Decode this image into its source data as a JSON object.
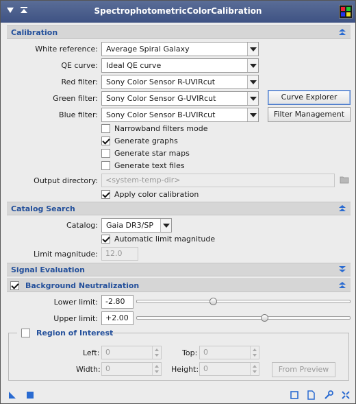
{
  "window": {
    "title": "SpectrophotometricColorCalibration"
  },
  "sections": {
    "calibration": "Calibration",
    "catalog_search": "Catalog Search",
    "signal_evaluation": "Signal Evaluation",
    "background_neutralization": "Background Neutralization"
  },
  "calibration": {
    "white_reference": {
      "label": "White reference:",
      "value": "Average Spiral Galaxy"
    },
    "qe_curve": {
      "label": "QE curve:",
      "value": "Ideal QE curve"
    },
    "red_filter": {
      "label": "Red filter:",
      "value": "Sony Color Sensor R-UVIRcut"
    },
    "green_filter": {
      "label": "Green filter:",
      "value": "Sony Color Sensor G-UVIRcut"
    },
    "blue_filter": {
      "label": "Blue filter:",
      "value": "Sony Color Sensor B-UVIRcut"
    },
    "curve_explorer": "Curve Explorer",
    "filter_management": "Filter Management",
    "narrowband": {
      "label": "Narrowband filters mode",
      "checked": false
    },
    "generate_graphs": {
      "label": "Generate graphs",
      "checked": true
    },
    "generate_star_maps": {
      "label": "Generate star maps",
      "checked": false
    },
    "generate_text_files": {
      "label": "Generate text files",
      "checked": false
    },
    "output_directory": {
      "label": "Output directory:",
      "placeholder": "<system-temp-dir>"
    },
    "apply_color_calibration": {
      "label": "Apply color calibration",
      "checked": true
    }
  },
  "catalog": {
    "label": "Catalog:",
    "value": "Gaia DR3/SP",
    "automatic_limit": {
      "label": "Automatic limit magnitude",
      "checked": true
    },
    "limit_magnitude": {
      "label": "Limit magnitude:",
      "value": "12.0"
    }
  },
  "background": {
    "enabled": true,
    "lower_limit": {
      "label": "Lower limit:",
      "value": "-2.80",
      "slider_fraction": 0.36
    },
    "upper_limit": {
      "label": "Upper limit:",
      "value": "+2.00",
      "slider_fraction": 0.6
    },
    "roi": {
      "title": "Region of Interest",
      "checked": false,
      "left": {
        "label": "Left:",
        "value": "0"
      },
      "top": {
        "label": "Top:",
        "value": "0"
      },
      "width": {
        "label": "Width:",
        "value": "0"
      },
      "height": {
        "label": "Height:",
        "value": "0"
      },
      "from_preview": "From Preview"
    }
  },
  "colors": {
    "title_bar": "#4a5e8e",
    "section_text": "#24509b",
    "accent": "#2a6bd1"
  },
  "icons": {
    "bottom_left": [
      "new-instance-icon",
      "apply-global-icon"
    ],
    "bottom_right": [
      "preview-icon",
      "documentation-icon",
      "reset-icon",
      "edit-instance-icon"
    ]
  }
}
